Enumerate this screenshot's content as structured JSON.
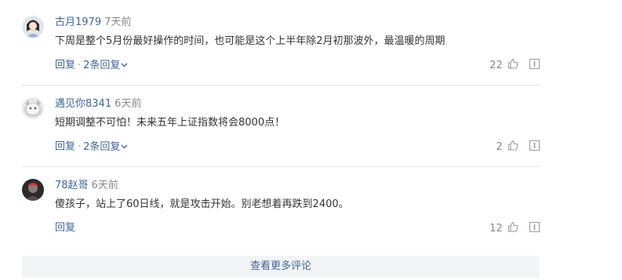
{
  "comments": [
    {
      "username": "古月1979",
      "time": "7天前",
      "text": "下周是整个5月份最好操作的时间，也可能是这个上半年除2月初那波外，最温暖的周期",
      "reply_label": "回复",
      "separator": "·",
      "replies_label": "2条回复",
      "likes": "22"
    },
    {
      "username": "遇见你8341",
      "time": "6天前",
      "text": "短期调整不可怕！未来五年上证指数将会8000点！",
      "reply_label": "回复",
      "separator": "·",
      "replies_label": "2条回复",
      "likes": "2"
    },
    {
      "username": "78赵哥",
      "time": "6天前",
      "text": "傻孩子，站上了60日线，就是攻击开始。别老想着再跌到2400。",
      "reply_label": "回复",
      "likes": "12"
    }
  ],
  "more_comments_label": "查看更多评论",
  "colors": {
    "link": "#406599",
    "text": "#333333",
    "muted": "#888888",
    "divider": "#e8e8e8",
    "more_bg": "#f3f4f6"
  },
  "icons": [
    "thumbs-up-icon",
    "report-icon",
    "chevron-down-icon"
  ]
}
